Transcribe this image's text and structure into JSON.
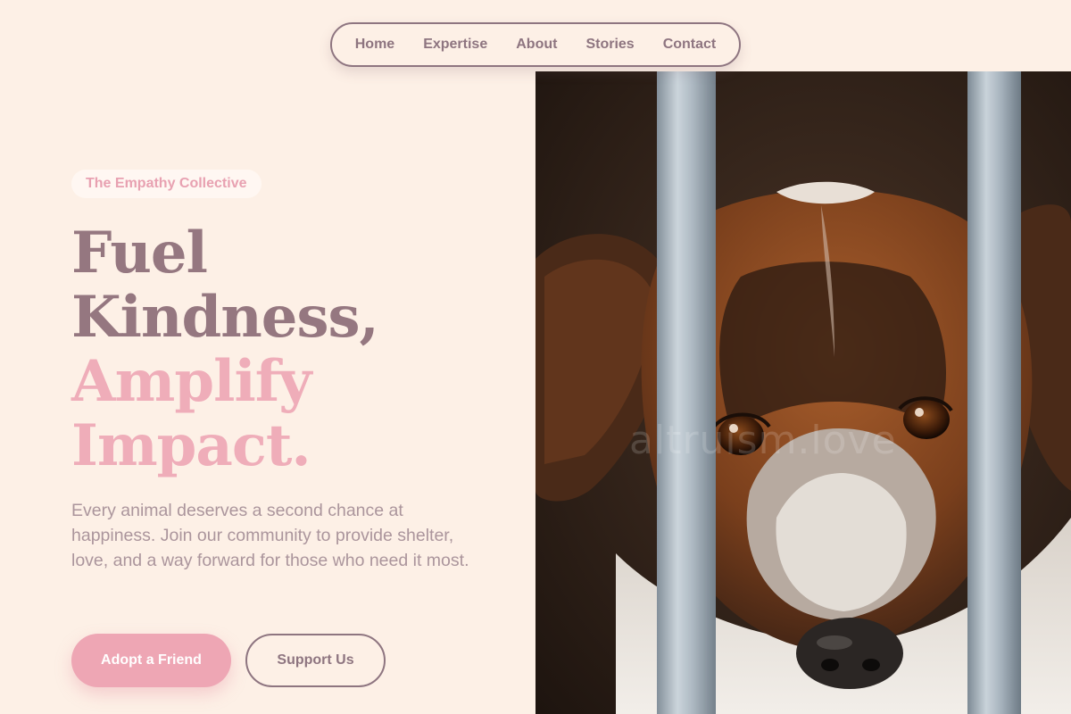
{
  "nav": {
    "items": [
      "Home",
      "Expertise",
      "About",
      "Stories",
      "Contact"
    ]
  },
  "hero": {
    "badge": "The Empathy Collective",
    "headline_line1": "Fuel",
    "headline_line2": "Kindness,",
    "headline_line3": "Amplify",
    "headline_line4": "Impact.",
    "description": "Every animal deserves a second chance at happiness. Join our community to provide shelter, love, and a way forward for those who need it most.",
    "primary_button": "Adopt a Friend",
    "secondary_button": "Support Us",
    "image_watermark": "altruism.love"
  },
  "colors": {
    "background": "#fdf0e6",
    "heading_dark": "#957780",
    "accent_pink": "#efadb9",
    "nav_text": "#8e7580"
  }
}
